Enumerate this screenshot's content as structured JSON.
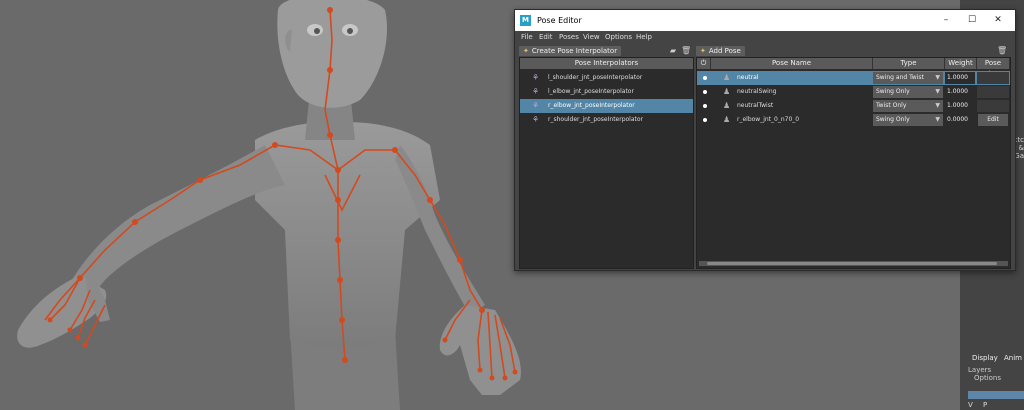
{
  "window": {
    "title": "Pose Editor",
    "app_icon": "M",
    "minimize": "–",
    "maximize": "☐",
    "close": "✕"
  },
  "menu": [
    "File",
    "Edit",
    "Poses",
    "View",
    "Options",
    "Help"
  ],
  "left_panel": {
    "create_button": "Create Pose Interpolator",
    "header": "Pose Interpolators",
    "items": [
      {
        "label": "l_shoulder_jnt_poseInterpolator",
        "selected": false
      },
      {
        "label": "l_elbow_jnt_poseInterpolator",
        "selected": false
      },
      {
        "label": "r_elbow_jnt_poseInterpolator",
        "selected": true
      },
      {
        "label": "r_shoulder_jnt_poseInterpolator",
        "selected": false
      }
    ]
  },
  "right_panel": {
    "add_button": "Add Pose",
    "columns": [
      "",
      "Pose Name",
      "Type",
      "Weight",
      "Pose Shap"
    ],
    "rows": [
      {
        "name": "neutral",
        "type": "Swing and Twist",
        "weight": "1.0000",
        "selected": true,
        "edit": ""
      },
      {
        "name": "neutralSwing",
        "type": "Swing Only",
        "weight": "1.0000",
        "selected": false,
        "edit": ""
      },
      {
        "name": "neutralTwist",
        "type": "Twist Only",
        "weight": "1.0000",
        "selected": false,
        "edit": ""
      },
      {
        "name": "r_elbow_jnt_0_n70_0",
        "type": "Swing Only",
        "weight": "0.0000",
        "selected": false,
        "edit": "Edit"
      }
    ]
  },
  "side_panel": {
    "fragment_lines": [
      "ojectс",
      "set &",
      "Ga"
    ],
    "tabs": [
      "Display",
      "Anim"
    ],
    "menu": [
      "Layers",
      "Options"
    ],
    "vp": [
      "V",
      "P"
    ]
  },
  "colors": {
    "accent": "#5285a6",
    "skeleton": "#d24a1e",
    "viewport": "#6a6a6a"
  }
}
